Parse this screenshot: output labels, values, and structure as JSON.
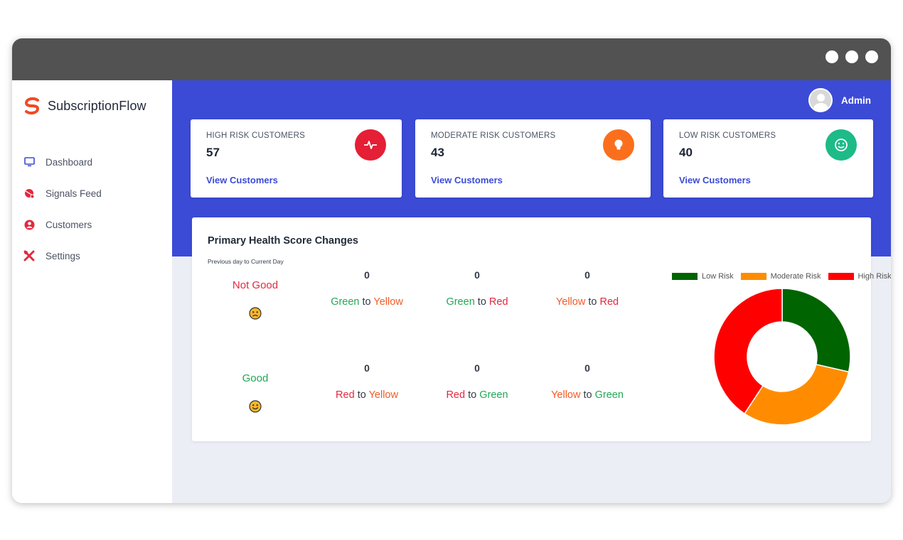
{
  "app": {
    "name": "SubscriptionFlow",
    "user": "Admin"
  },
  "sidebar": {
    "items": [
      {
        "label": "Dashboard",
        "icon": "monitor-icon"
      },
      {
        "label": "Signals Feed",
        "icon": "signal-icon"
      },
      {
        "label": "Customers",
        "icon": "user-icon"
      },
      {
        "label": "Settings",
        "icon": "tools-icon"
      }
    ]
  },
  "cards": [
    {
      "title": "HIGH RISK CUSTOMERS",
      "count": "57",
      "link": "View Customers",
      "icon": "pulse-icon",
      "color": "#e51f35"
    },
    {
      "title": "MODERATE RISK CUSTOMERS",
      "count": "43",
      "link": "View Customers",
      "icon": "lightbulb-icon",
      "color": "#fb6f1c"
    },
    {
      "title": "LOW RISK CUSTOMERS",
      "count": "40",
      "link": "View Customers",
      "icon": "smile-icon",
      "color": "#1dbb87"
    }
  ],
  "health": {
    "title": "Primary Health Score Changes",
    "subtitle": "Previous day to Current Day",
    "not_good": {
      "label": "Not Good",
      "metrics": [
        {
          "value": "0",
          "from": "Green",
          "to_word": "to",
          "target": "Yellow"
        },
        {
          "value": "0",
          "from": "Green",
          "to_word": "to",
          "target": "Red"
        },
        {
          "value": "0",
          "from": "Yellow",
          "to_word": "to",
          "target": "Red"
        }
      ]
    },
    "good": {
      "label": "Good",
      "metrics": [
        {
          "value": "0",
          "from": "Red",
          "to_word": "to",
          "target": "Yellow"
        },
        {
          "value": "0",
          "from": "Red",
          "to_word": "to",
          "target": "Green"
        },
        {
          "value": "0",
          "from": "Yellow",
          "to_word": "to",
          "target": "Green"
        }
      ]
    }
  },
  "chart_data": {
    "type": "pie",
    "donut": true,
    "legend_position": "top",
    "series": [
      {
        "name": "Low Risk",
        "value": 40,
        "color": "#006400"
      },
      {
        "name": "Moderate Risk",
        "value": 43,
        "color": "#ff8c00"
      },
      {
        "name": "High Risk",
        "value": 57,
        "color": "#ff0000"
      }
    ]
  },
  "colors": {
    "accent": "#3b4bd6",
    "titlebar": "#525252"
  }
}
